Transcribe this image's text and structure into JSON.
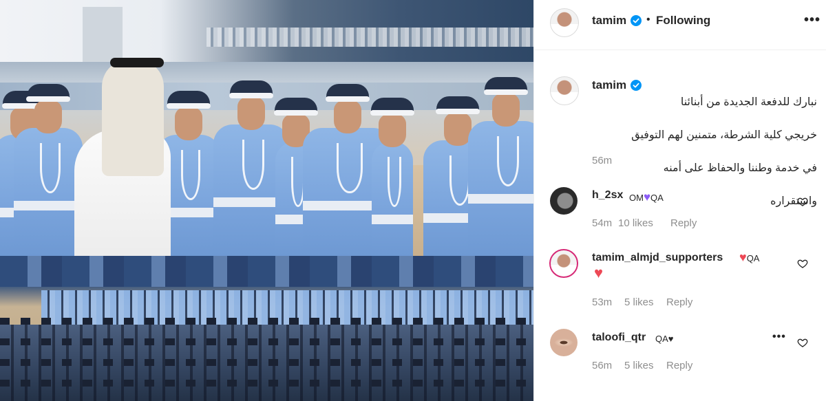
{
  "post": {
    "author": "tamim",
    "follow_status": "Following",
    "separator": "•",
    "more": "•••",
    "caption_lines": [
      "نبارك للدفعة الجديدة من أبنائنا",
      "خريجي كلية الشرطة، متمنين لهم التوفيق",
      "في خدمة وطننا والحفاظ على أمنه",
      "واستقراره"
    ],
    "caption_time": "56m"
  },
  "comments": [
    {
      "username": "h_2sx",
      "text_before": "OM",
      "heart": "💜",
      "text_after": "QA",
      "time": "54m",
      "likes": "10 likes",
      "reply": "Reply"
    },
    {
      "username": "tamim_almjd_supporters",
      "heart": "❤",
      "text_after": "QA",
      "heart2": "❤",
      "time": "53m",
      "likes": "5 likes",
      "reply": "Reply"
    },
    {
      "username": "taloofi_qtr",
      "text_after": "QA♥",
      "time": "56m",
      "likes": "5 likes",
      "reply": "Reply"
    }
  ],
  "colors": {
    "verified_blue": "#0095f6",
    "meta_gray": "#8e8e8e",
    "like_red": "#ed4956"
  }
}
